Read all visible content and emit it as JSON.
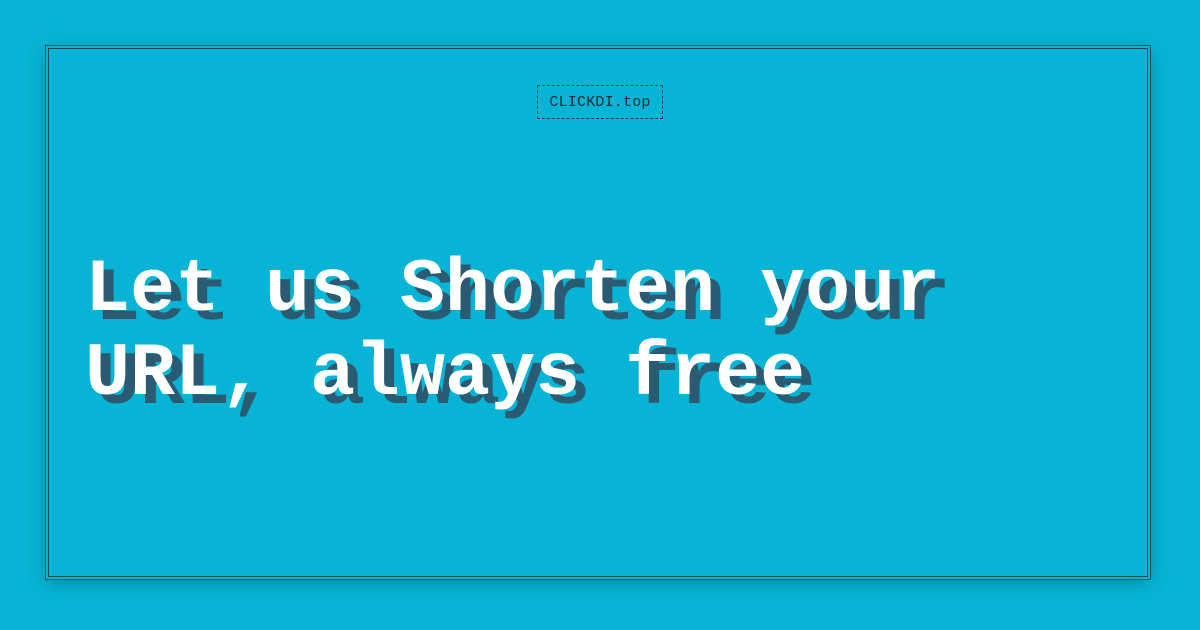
{
  "brand": {
    "label": "CLICKDI.top"
  },
  "hero": {
    "headline": "Let us Shorten your\nURL, always free"
  },
  "colors": {
    "background": "#07b4d5",
    "headline_text": "#ffffff",
    "headline_shadow": "#2a5b72",
    "border": "#1d4c5c"
  }
}
